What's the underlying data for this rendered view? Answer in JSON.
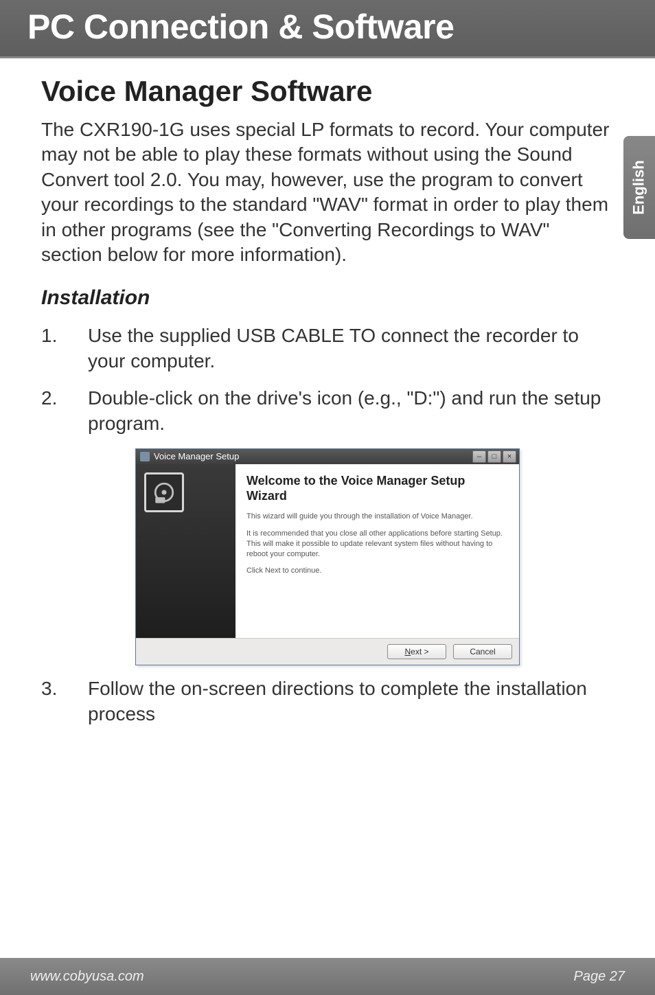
{
  "header": {
    "title": "PC Connection & Software"
  },
  "sidetab": {
    "label": "English"
  },
  "section": {
    "title": "Voice Manager Software"
  },
  "intro": "The CXR190-1G uses special LP formats to record. Your computer may not be able to play these formats without using the Sound Convert tool 2.0. You may, however, use the program to convert your recordings to the standard \"WAV\" format in order to play them in other programs (see the \"Converting Recordings to WAV\" section below for more information).",
  "subsection": {
    "title": "Installation"
  },
  "steps": [
    "Use the supplied USB CABLE TO connect the recorder to your computer.",
    "Double-click on the drive's icon (e.g., \"D:\") and run the setup program.",
    "Follow the on-screen directions to complete the installation process"
  ],
  "dialog": {
    "titlebar": "Voice Manager Setup",
    "heading": "Welcome to the Voice Manager Setup Wizard",
    "p1": "This wizard will guide you through the installation of Voice Manager.",
    "p2": "It is recommended that you close all other applications before starting Setup. This will make it possible to update relevant system files without having to reboot your computer.",
    "p3": "Click Next to continue.",
    "next": "Next >",
    "next_u": "N",
    "cancel": "Cancel",
    "min": "–",
    "max": "□",
    "close": "×"
  },
  "footer": {
    "url": "www.cobyusa.com",
    "page": "Page 27"
  }
}
